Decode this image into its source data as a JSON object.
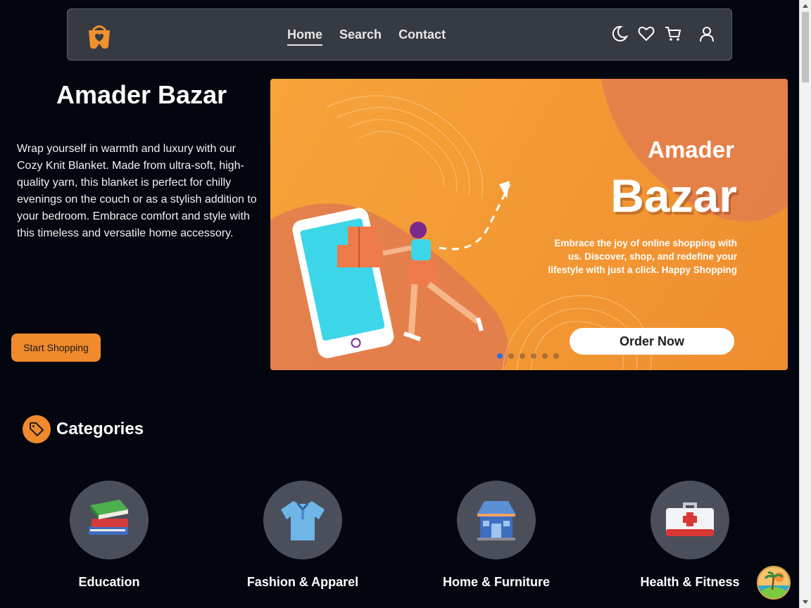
{
  "navbar": {
    "links": [
      "Home",
      "Search",
      "Contact"
    ],
    "active_link": "Home",
    "icons": [
      "theme-moon-icon",
      "wishlist-heart-icon",
      "cart-icon",
      "user-icon"
    ]
  },
  "hero": {
    "title": "Amader Bazar",
    "description": "Wrap yourself in warmth and luxury with our Cozy Knit Blanket. Made from ultra-soft, high-quality yarn, this blanket is perfect for chilly evenings on the couch or as a stylish addition to your bedroom. Embrace comfort and style with this timeless and versatile home accessory.",
    "cta_label": "Start Shopping"
  },
  "banner": {
    "word1": "Amader",
    "word2": "Bazar",
    "text": "Embrace the joy of online shopping with us. Discover, shop, and redefine your lifestyle with just a click. Happy Shopping",
    "button_label": "Order Now",
    "slide_count": 6,
    "active_slide": 1
  },
  "categories": {
    "title": "Categories",
    "items": [
      {
        "label": "Education",
        "icon": "books-icon"
      },
      {
        "label": "Fashion & Apparel",
        "icon": "shirt-icon"
      },
      {
        "label": "Home & Furniture",
        "icon": "store-icon"
      },
      {
        "label": "Health & Fitness",
        "icon": "first-aid-kit-icon"
      }
    ]
  },
  "colors": {
    "background": "#03060f",
    "accent": "#f08a2c",
    "navbar": "#363a42",
    "category_circle": "#4a4f5b"
  }
}
